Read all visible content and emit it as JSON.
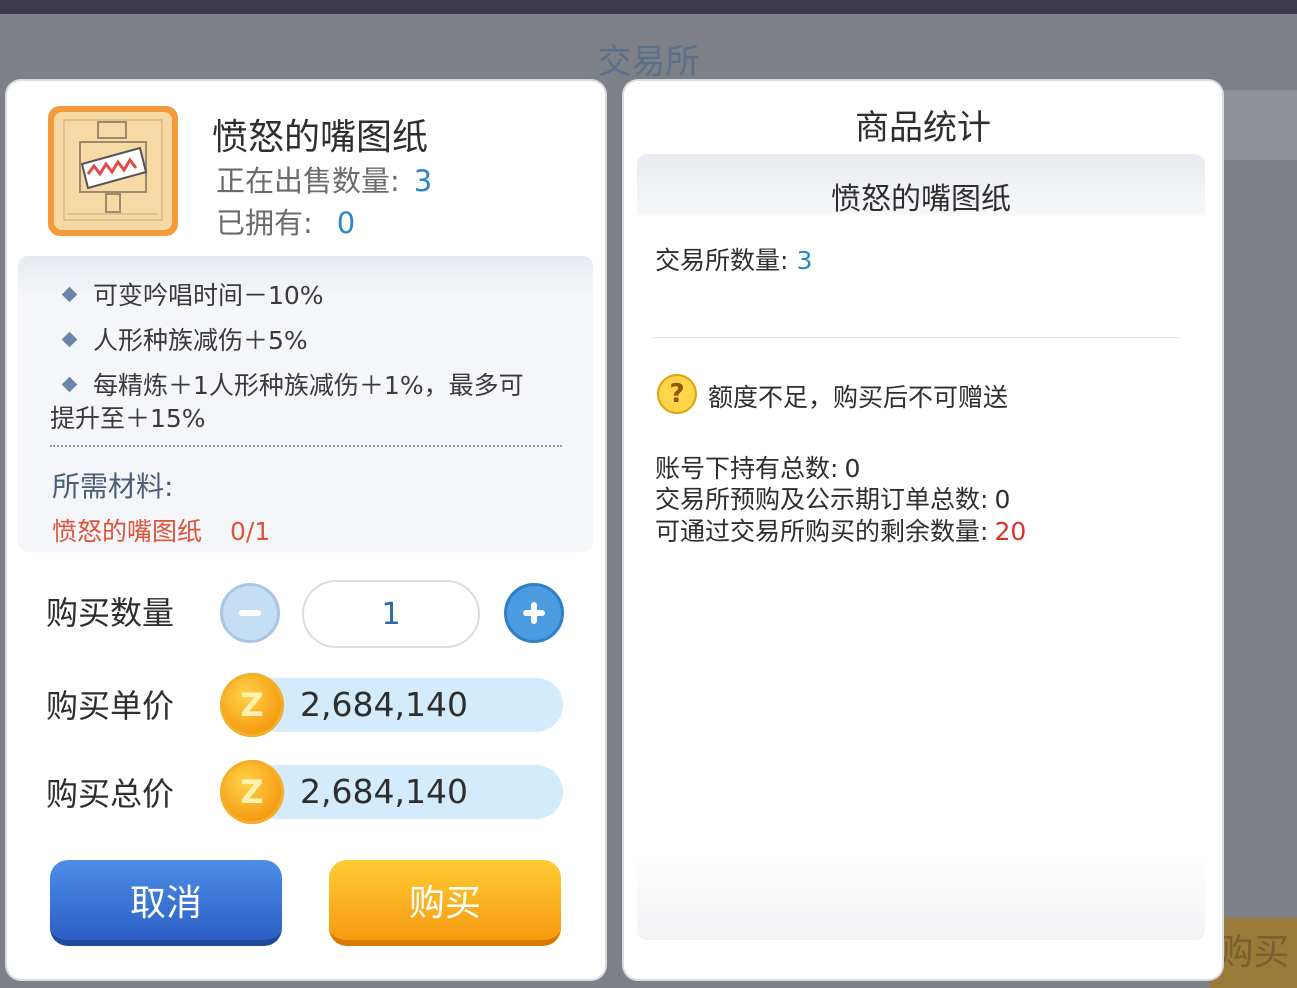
{
  "background": {
    "title": "交易所",
    "corner_label": "购买"
  },
  "item": {
    "name": "愤怒的嘴图纸",
    "on_sale_label": "正在出售数量:",
    "on_sale_value": "3",
    "owned_label": "已拥有:",
    "owned_value": "0",
    "attributes": [
      "可变吟唱时间－10%",
      "人形种族减伤＋5%",
      "每精炼＋1人形种族减伤＋1%，最多可"
    ],
    "attribute_wrap": "提升至＋15%",
    "materials_title": "所需材料:",
    "materials": [
      {
        "name": "愤怒的嘴图纸",
        "count": "0/1"
      }
    ]
  },
  "purchase": {
    "quantity_label": "购买数量",
    "quantity_value": "1",
    "unit_price_label": "购买单价",
    "unit_price": "2,684,140",
    "total_price_label": "购买总价",
    "total_price": "2,684,140",
    "cancel_label": "取消",
    "buy_label": "购买",
    "currency_icon": "zeny-coin-icon"
  },
  "stats": {
    "title": "商品统计",
    "item_name": "愤怒的嘴图纸",
    "exchange_count_label": "交易所数量:",
    "exchange_count_value": "3",
    "warning": "额度不足，购买后不可赠送",
    "account_total_label": "账号下持有总数:",
    "account_total_value": "0",
    "preorder_total_label": "交易所预购及公示期订单总数:",
    "preorder_total_value": "0",
    "remaining_label": "可通过交易所购买的剩余数量:",
    "remaining_value": "20"
  },
  "colors": {
    "accent_blue": "#2a86c6",
    "warning_red": "#d9342a",
    "buy_orange": "#f79a12",
    "cancel_blue": "#2c5fc4"
  }
}
